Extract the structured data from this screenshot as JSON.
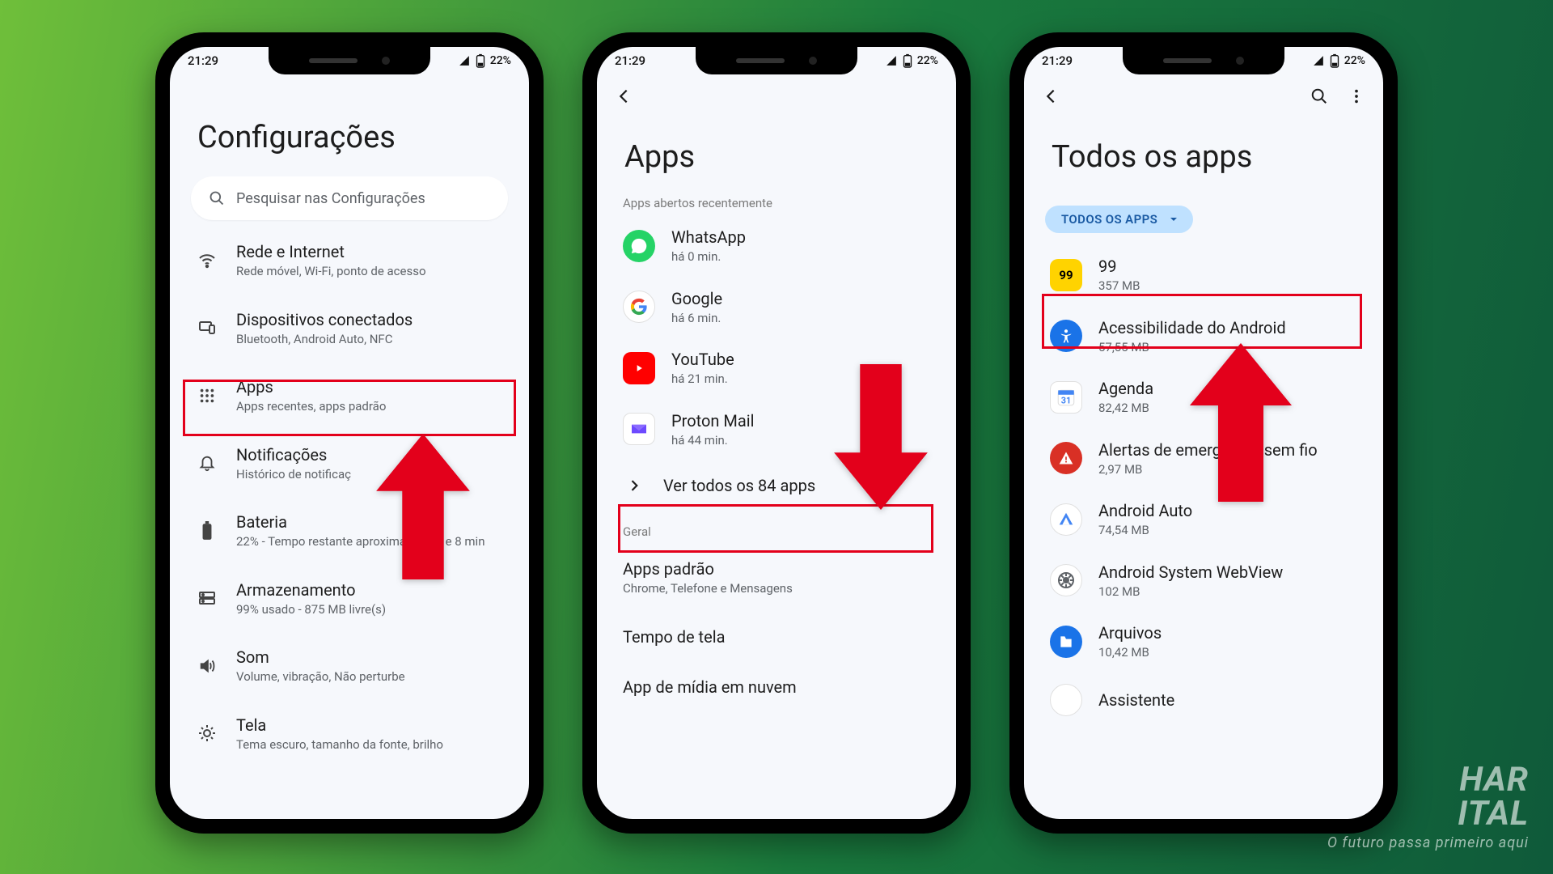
{
  "status": {
    "time": "21:29",
    "battery": "22%"
  },
  "screen1": {
    "title": "Configurações",
    "search_placeholder": "Pesquisar nas Configurações",
    "items": [
      {
        "title": "Rede e Internet",
        "sub": "Rede móvel, Wi-Fi, ponto de acesso"
      },
      {
        "title": "Dispositivos conectados",
        "sub": "Bluetooth, Android Auto, NFC"
      },
      {
        "title": "Apps",
        "sub": "Apps recentes, apps padrão"
      },
      {
        "title": "Notificações",
        "sub": "Histórico de notificaç"
      },
      {
        "title": "Bateria",
        "sub": "22% - Tempo restante aproximado: 7 h e 8 min"
      },
      {
        "title": "Armazenamento",
        "sub": "99% usado - 875 MB livre(s)"
      },
      {
        "title": "Som",
        "sub": "Volume, vibração, Não perturbe"
      },
      {
        "title": "Tela",
        "sub": "Tema escuro, tamanho da fonte, brilho"
      }
    ]
  },
  "screen2": {
    "title": "Apps",
    "section_recent": "Apps abertos recentemente",
    "recent": [
      {
        "name": "WhatsApp",
        "sub": "há 0 min."
      },
      {
        "name": "Google",
        "sub": "há 6 min."
      },
      {
        "name": "YouTube",
        "sub": "há 21 min."
      },
      {
        "name": "Proton Mail",
        "sub": "há 44 min."
      }
    ],
    "see_all": "Ver todos os 84 apps",
    "section_general": "Geral",
    "general": [
      {
        "title": "Apps padrão",
        "sub": "Chrome, Telefone e Mensagens"
      },
      {
        "title": "Tempo de tela",
        "sub": ""
      },
      {
        "title": "App de mídia em nuvem",
        "sub": ""
      }
    ]
  },
  "screen3": {
    "title": "Todos os apps",
    "filter_label": "TODOS OS APPS",
    "apps": [
      {
        "name": "99",
        "sub": "357 MB"
      },
      {
        "name": "Acessibilidade do Android",
        "sub": "57,55 MB"
      },
      {
        "name": "Agenda",
        "sub": "82,42 MB"
      },
      {
        "name": "Alertas de emergência sem fio",
        "sub": "2,97 MB"
      },
      {
        "name": "Android Auto",
        "sub": "74,54 MB"
      },
      {
        "name": "Android System WebView",
        "sub": "102 MB"
      },
      {
        "name": "Arquivos",
        "sub": "10,42 MB"
      },
      {
        "name": "Assistente",
        "sub": ""
      }
    ]
  },
  "watermark": {
    "big": "HAR",
    "big2": "ITAL",
    "small": "O futuro passa primeiro aqui"
  }
}
